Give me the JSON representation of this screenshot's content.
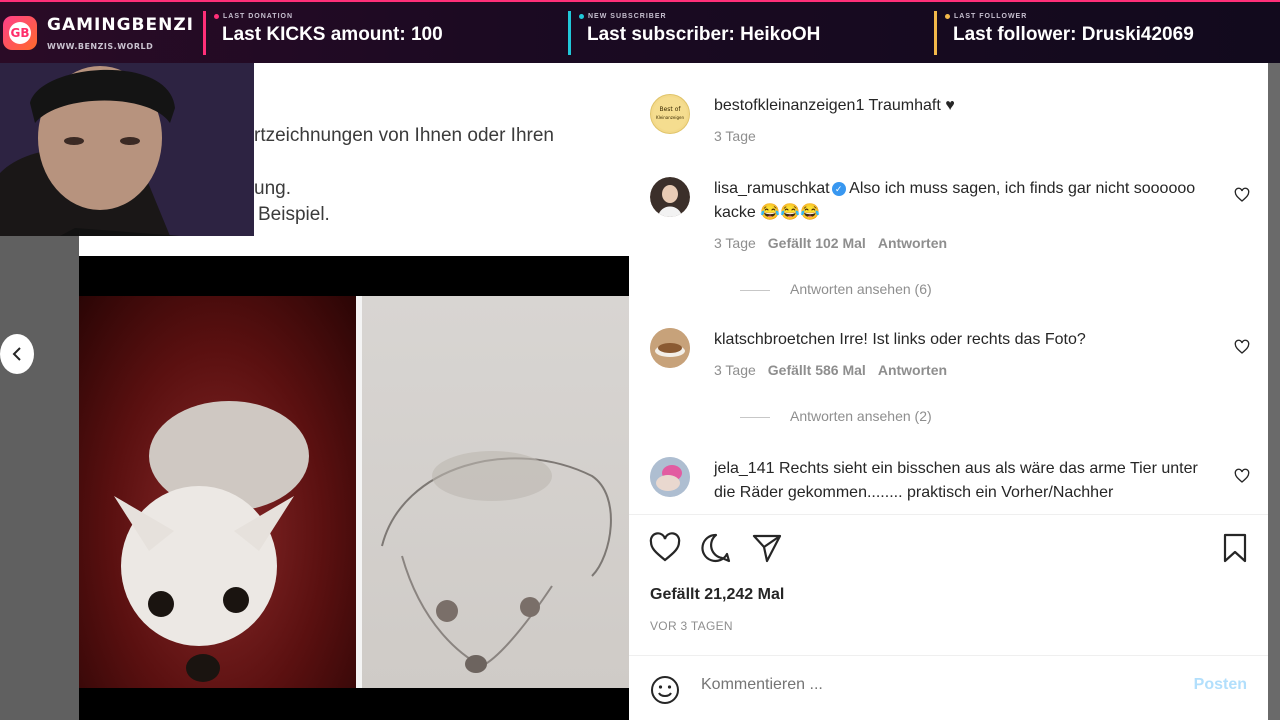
{
  "overlay": {
    "brand_name": "GAMINGBENZI",
    "brand_badge": "GB",
    "brand_url": "WWW.BENZIS.WORLD",
    "alerts": [
      {
        "tag": "LAST DONATION",
        "text": "Last KICKS amount: 100",
        "color": "#ff2f78"
      },
      {
        "tag": "NEW SUBSCRIBER",
        "text": "Last subscriber: HeikoOH",
        "color": "#21c7d9"
      },
      {
        "tag": "LAST FOLLOWER",
        "text": "Last follower: Druski42069",
        "color": "#f2b84a"
      }
    ]
  },
  "article": {
    "lines": [
      "rtzeichnungen von Ihnen oder Ihren",
      "ung.",
      "Beispiel."
    ]
  },
  "instagram": {
    "comments": [
      {
        "user": "bestofkleinanzeigen1",
        "text": "Traumhaft ♥",
        "time": "3 Tage",
        "likes": "",
        "reply": "",
        "replies_label": "",
        "avatar_label": "Best of Kleinanzeigen"
      },
      {
        "user": "lisa_ramuschkat",
        "verified": true,
        "text": "Also ich muss sagen, ich finds gar nicht soooooo kacke 😂😂😂",
        "time": "3 Tage",
        "likes": "Gefällt 102 Mal",
        "reply": "Antworten",
        "replies_label": "Antworten ansehen (6)"
      },
      {
        "user": "klatschbroetchen",
        "text": "Irre! Ist links oder rechts das Foto?",
        "time": "3 Tage",
        "likes": "Gefällt 586 Mal",
        "reply": "Antworten",
        "replies_label": "Antworten ansehen (2)"
      },
      {
        "user": "jela_141",
        "text": "Rechts sieht ein bisschen aus als wäre das arme Tier unter die Räder gekommen........ praktisch ein Vorher/Nachher",
        "time": "",
        "likes": "",
        "reply": "",
        "replies_label": ""
      }
    ],
    "likes_total": "Gefällt 21,242 Mal",
    "posted": "VOR 3 TAGEN",
    "comment_placeholder": "Kommentieren ...",
    "post_label": "Posten"
  },
  "icons": [
    "heart-icon",
    "comment-icon",
    "share-icon",
    "bookmark-icon",
    "emoji-icon",
    "chevron-left-icon"
  ],
  "colors": {
    "accent_pink": "#ff2f78",
    "accent_cyan": "#21c7d9",
    "accent_gold": "#f2b84a",
    "ig_link": "#b2dffc"
  }
}
